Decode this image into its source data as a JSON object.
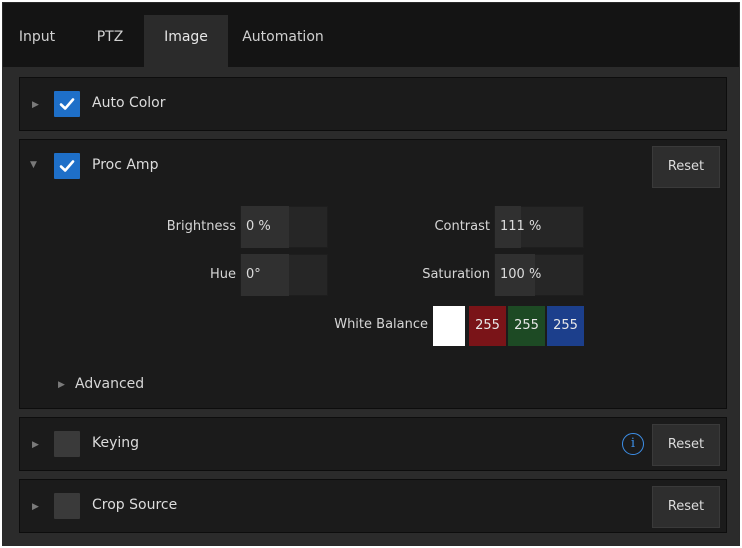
{
  "tabs": [
    {
      "label": "Input"
    },
    {
      "label": "PTZ"
    },
    {
      "label": "Image"
    },
    {
      "label": "Automation"
    }
  ],
  "sections": {
    "auto_color": {
      "title": "Auto Color",
      "checked": true
    },
    "proc_amp": {
      "title": "Proc Amp",
      "checked": true,
      "reset_label": "Reset",
      "brightness": {
        "label": "Brightness",
        "value": "0 %"
      },
      "contrast": {
        "label": "Contrast",
        "value": "111 %"
      },
      "hue": {
        "label": "Hue",
        "value": "0°"
      },
      "saturation": {
        "label": "Saturation",
        "value": "100 %"
      },
      "white_balance": {
        "label": "White Balance",
        "r": "255",
        "g": "255",
        "b": "255"
      },
      "advanced_label": "Advanced"
    },
    "keying": {
      "title": "Keying",
      "checked": false,
      "reset_label": "Reset",
      "info_glyph": "i"
    },
    "crop_source": {
      "title": "Crop Source",
      "checked": false,
      "reset_label": "Reset"
    }
  },
  "colors": {
    "accent": "#1e6fc8",
    "wb_white": "#ffffff",
    "wb_red": "#7a1418",
    "wb_green": "#1d4a24",
    "wb_blue": "#1c3f8c"
  }
}
